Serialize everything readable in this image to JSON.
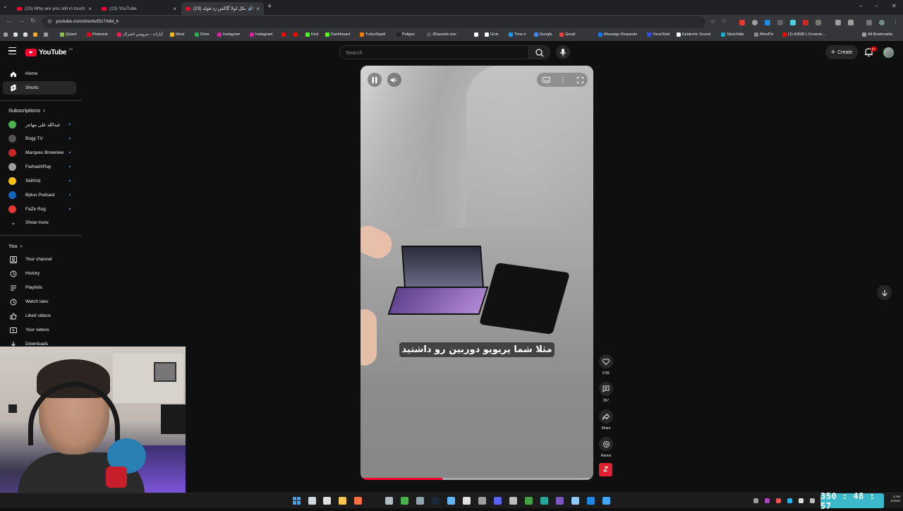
{
  "browser": {
    "tabs": [
      {
        "title": "(23) Why are you still in touch with"
      },
      {
        "title": "(23) YouTube"
      },
      {
        "title": "(23) شکل لولا گاکس زد فولد"
      }
    ],
    "url": "youtube.com/shorts/I5z7Atbt_k",
    "bookmarks": [
      {
        "label": "Quixel",
        "color": "#8bc34a"
      },
      {
        "label": "Pinterest",
        "color": "#e60023"
      },
      {
        "label": "آپارات - سرویس اشتراک",
        "color": "#ea1d5d"
      },
      {
        "label": "Meet",
        "color": "#fbbc04"
      },
      {
        "label": "Drive",
        "color": "#34a853"
      },
      {
        "label": "Instagram",
        "color": "#d6249f"
      },
      {
        "label": "Instagram",
        "color": "#d6249f"
      },
      {
        "label": "",
        "color": "#ff0000"
      },
      {
        "label": "",
        "color": "#ff0000"
      },
      {
        "label": "Kick",
        "color": "#53fc18"
      },
      {
        "label": "Dashboard",
        "color": "#53fc18"
      },
      {
        "label": "TurboSquid",
        "color": "#f57c00"
      },
      {
        "label": "Poligon",
        "color": "#222222"
      },
      {
        "label": "3Dassets.one",
        "color": "#555555"
      },
      {
        "label": "",
        "color": "#ffffff"
      },
      {
        "label": "Grok",
        "color": "#ffffff"
      },
      {
        "label": "Time.ir",
        "color": "#2196f3"
      },
      {
        "label": "Google",
        "color": "#4285f4"
      },
      {
        "label": "Gmail",
        "color": "#ea4335"
      },
      {
        "label": "Message Requests",
        "color": "#1877f2"
      },
      {
        "label": "VirusTotal",
        "color": "#394eff"
      },
      {
        "label": "Epidemic Sound",
        "color": "#ffffff"
      },
      {
        "label": "Sketchfab",
        "color": "#1caad9"
      },
      {
        "label": "MinePic",
        "color": "#888888"
      },
      {
        "label": "(1) ASMR | Ceramic...",
        "color": "#ff0000"
      }
    ],
    "all_bookmarks": "All Bookmarks"
  },
  "youtube": {
    "logo_text": "YouTube",
    "logo_region": "GB",
    "search_placeholder": "Search",
    "create_label": "Create",
    "notif_count": "9+",
    "sidebar": {
      "main": [
        {
          "label": "Home",
          "icon": "home-icon"
        },
        {
          "label": "Shorts",
          "icon": "shorts-icon"
        }
      ],
      "subscriptions_title": "Subscriptions",
      "subscriptions": [
        {
          "label": "عبدالله علی مهاجر",
          "color": "#4caf50"
        },
        {
          "label": "Bogy TV",
          "color": "#555555"
        },
        {
          "label": "Marques Brownlee",
          "color": "#c62828"
        },
        {
          "label": "FarhadXRay",
          "color": "#9e9e9e"
        },
        {
          "label": "SkillVid",
          "color": "#ffc107"
        },
        {
          "label": "Bplus Podcast",
          "color": "#1565c0"
        },
        {
          "label": "FaZe Rug",
          "color": "#e53935"
        }
      ],
      "show_more": "Show more",
      "you_title": "You",
      "you": [
        {
          "label": "Your channel",
          "icon": "channel-icon"
        },
        {
          "label": "History",
          "icon": "history-icon"
        },
        {
          "label": "Playlists",
          "icon": "playlists-icon"
        },
        {
          "label": "Watch later",
          "icon": "watch-later-icon"
        },
        {
          "label": "Liked videos",
          "icon": "like-icon"
        },
        {
          "label": "Your videos",
          "icon": "your-videos-icon"
        },
        {
          "label": "Downloads",
          "icon": "download-icon"
        }
      ]
    },
    "short": {
      "subtitle": "مثلا شما پریویو دوربین رو داشتید",
      "progress": 0.35,
      "actions": [
        {
          "label": "9.5K",
          "icon": "like-icon"
        },
        {
          "label": "267",
          "icon": "comment-icon"
        },
        {
          "label": "Share",
          "icon": "share-icon"
        },
        {
          "label": "Remix",
          "icon": "remix-icon"
        }
      ]
    }
  },
  "stream": {
    "timer": "350 : 48 : 57",
    "clock_time": "3 AM",
    "clock_date": "1/2026"
  }
}
